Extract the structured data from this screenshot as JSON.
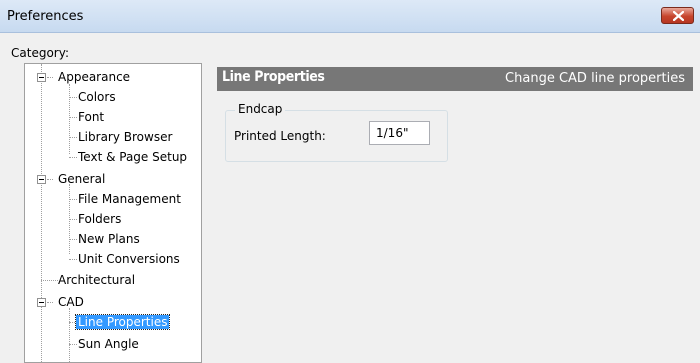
{
  "window": {
    "title": "Preferences",
    "close_icon": "close-icon"
  },
  "category_label": "Category:",
  "tree": {
    "items": [
      {
        "label": "Appearance"
      },
      {
        "label": "Colors"
      },
      {
        "label": "Font"
      },
      {
        "label": "Library Browser"
      },
      {
        "label": "Text & Page Setup"
      },
      {
        "label": "General"
      },
      {
        "label": "File Management"
      },
      {
        "label": "Folders"
      },
      {
        "label": "New Plans"
      },
      {
        "label": "Unit Conversions"
      },
      {
        "label": "Architectural"
      },
      {
        "label": "CAD"
      },
      {
        "label": "Line Properties",
        "selected": true
      },
      {
        "label": "Sun Angle"
      }
    ],
    "selection_color": "#3399ff"
  },
  "panel": {
    "title": "Line Properties",
    "subtitle": "Change CAD line properties",
    "header_color": "#777777",
    "group": {
      "legend": "Endcap",
      "printed_length_label": "Printed Length:",
      "printed_length_value": "1/16\""
    }
  }
}
